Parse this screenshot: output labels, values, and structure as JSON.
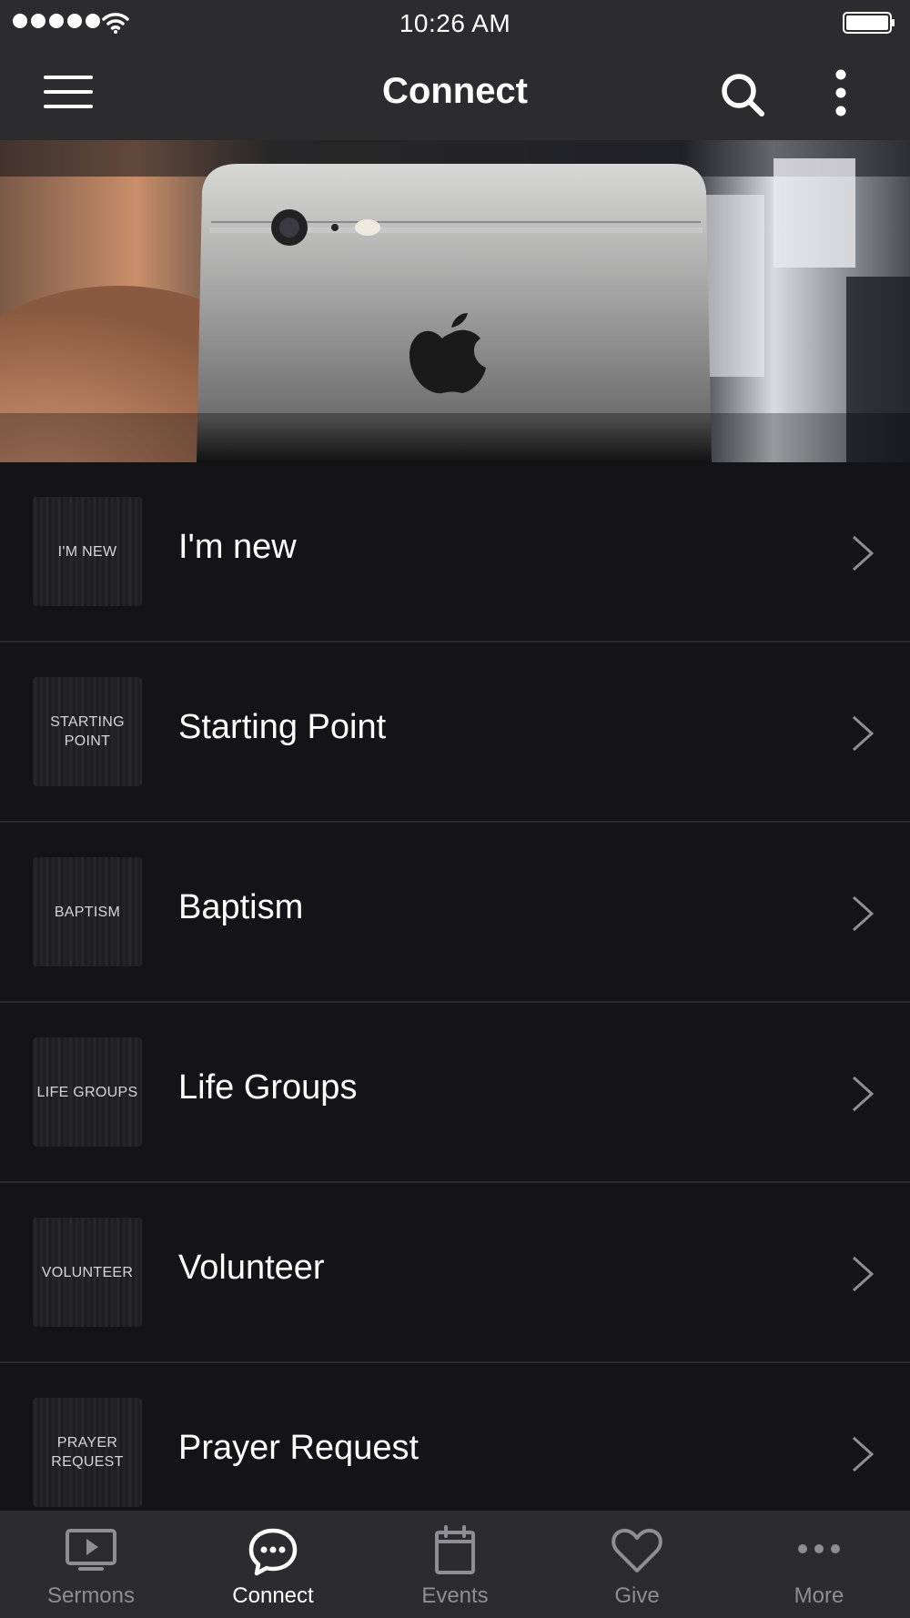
{
  "status_bar": {
    "time": "10:26 AM"
  },
  "nav": {
    "title": "Connect"
  },
  "hero": {
    "icon": "phone-photo-banner"
  },
  "list": [
    {
      "thumb_text": "I'M NEW",
      "label": "I'm new"
    },
    {
      "thumb_text": "STARTING POINT",
      "label": "Starting Point"
    },
    {
      "thumb_text": "BAPTISM",
      "label": "Baptism"
    },
    {
      "thumb_text": "LIFE GROUPS",
      "label": "Life Groups"
    },
    {
      "thumb_text": "VOLUNTEER",
      "label": "Volunteer"
    },
    {
      "thumb_text": "PRAYER REQUEST",
      "label": "Prayer Request"
    }
  ],
  "tabs": [
    {
      "label": "Sermons",
      "icon": "tv-play-icon"
    },
    {
      "label": "Connect",
      "icon": "chat-bubble-icon"
    },
    {
      "label": "Events",
      "icon": "calendar-icon"
    },
    {
      "label": "Give",
      "icon": "heart-icon"
    },
    {
      "label": "More",
      "icon": "more-dots-icon"
    }
  ],
  "colors": {
    "bar_background": "#2c2c2e",
    "list_background": "#141417",
    "active_tab": "#ffffff",
    "inactive_tab": "#8e8e93"
  }
}
